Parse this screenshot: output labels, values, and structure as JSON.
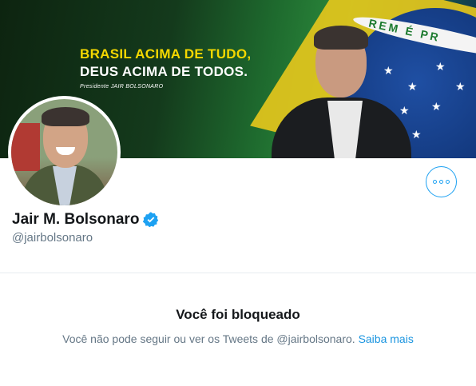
{
  "banner": {
    "headline_line1": "BRASIL ACIMA DE TUDO,",
    "headline_line2": "DEUS ACIMA DE TODOS.",
    "signature": "Presidente JAIR BOLSONARO",
    "flag_text": "REM É PR",
    "colors": {
      "yellow": "#f5d800",
      "green": "#1e6a2e",
      "blue": "#0b2a66"
    }
  },
  "profile": {
    "name": "Jair M. Bolsonaro",
    "handle": "@jairbolsonaro",
    "verified": true,
    "verified_icon": "verified-badge-icon"
  },
  "actions": {
    "more_icon": "more-options-icon"
  },
  "blocked": {
    "title": "Você foi bloqueado",
    "message": "Você não pode seguir ou ver os Tweets de @jairbolsonaro.",
    "link": "Saiba mais"
  },
  "colors": {
    "accent": "#1da1f2",
    "link": "#1b95e0",
    "secondary_text": "#657786",
    "primary_text": "#14171a",
    "divider": "#e6ecf0"
  }
}
